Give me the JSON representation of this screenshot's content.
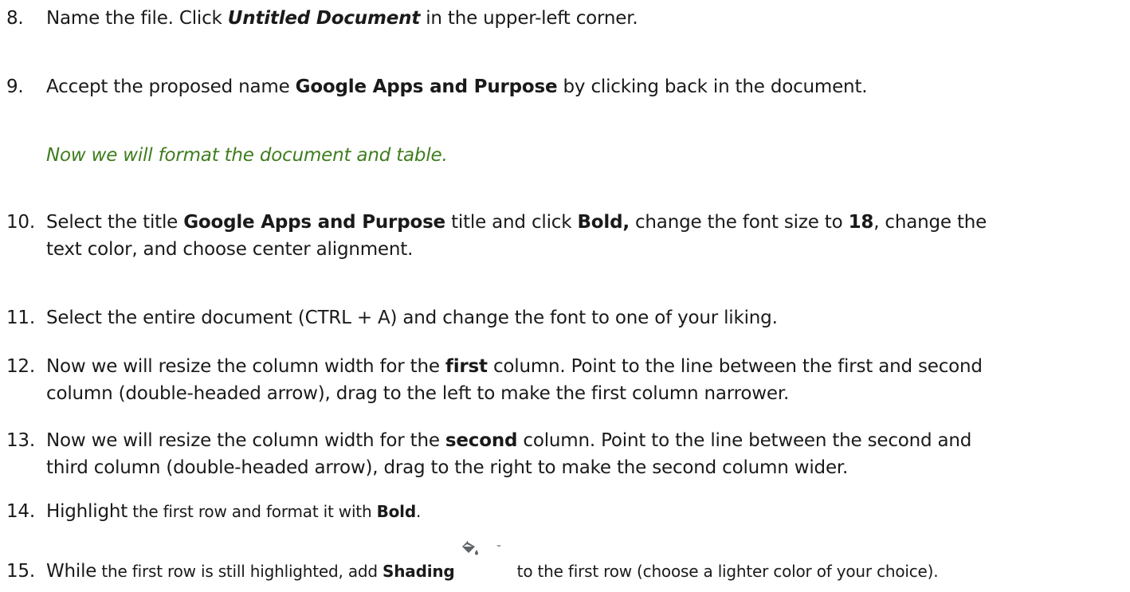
{
  "steps": [
    {
      "num": "8.",
      "parts": [
        "Name the file. Click ",
        "Untitled Document",
        " in the upper-left corner."
      ]
    },
    {
      "num": "9.",
      "parts": [
        "Accept the proposed name ",
        "Google Apps and Purpose",
        " by clicking back in the document."
      ]
    },
    {
      "note": "Now we will format the document and table."
    },
    {
      "num": "10.",
      "parts": [
        "Select the title ",
        "Google Apps and Purpose",
        " title and click ",
        "Bold,",
        " change the font size to ",
        "18",
        ", change the",
        "text color, and choose center alignment."
      ]
    },
    {
      "num": "11.",
      "parts": [
        "Select the entire document (CTRL + A) and change the font to one of your liking."
      ]
    },
    {
      "num": "12.",
      "parts": [
        "Now we will resize the column width for the ",
        "first",
        " column. Point to the line between the first and second",
        "column (double-headed arrow), drag to the left to make the first column narrower."
      ]
    },
    {
      "num": "13.",
      "parts": [
        "Now we will resize the column width for the ",
        "second",
        " column. Point to the line between the second and",
        "third column (double-headed arrow), drag to the right to make the second column wider."
      ]
    },
    {
      "num": "14.",
      "parts": [
        "Highlight",
        " the first row and format it with ",
        "Bold",
        "."
      ]
    },
    {
      "num": "15.",
      "parts": [
        "While",
        " the first row is still highlighted, add ",
        "Shading",
        " to the first row (choose a lighter color of your choice)."
      ]
    }
  ],
  "icons": {
    "shading": "paint-bucket-icon",
    "dropdown": "dropdown-arrow-icon"
  },
  "colors": {
    "text": "#1a1a1a",
    "note": "#3f7d1e"
  }
}
